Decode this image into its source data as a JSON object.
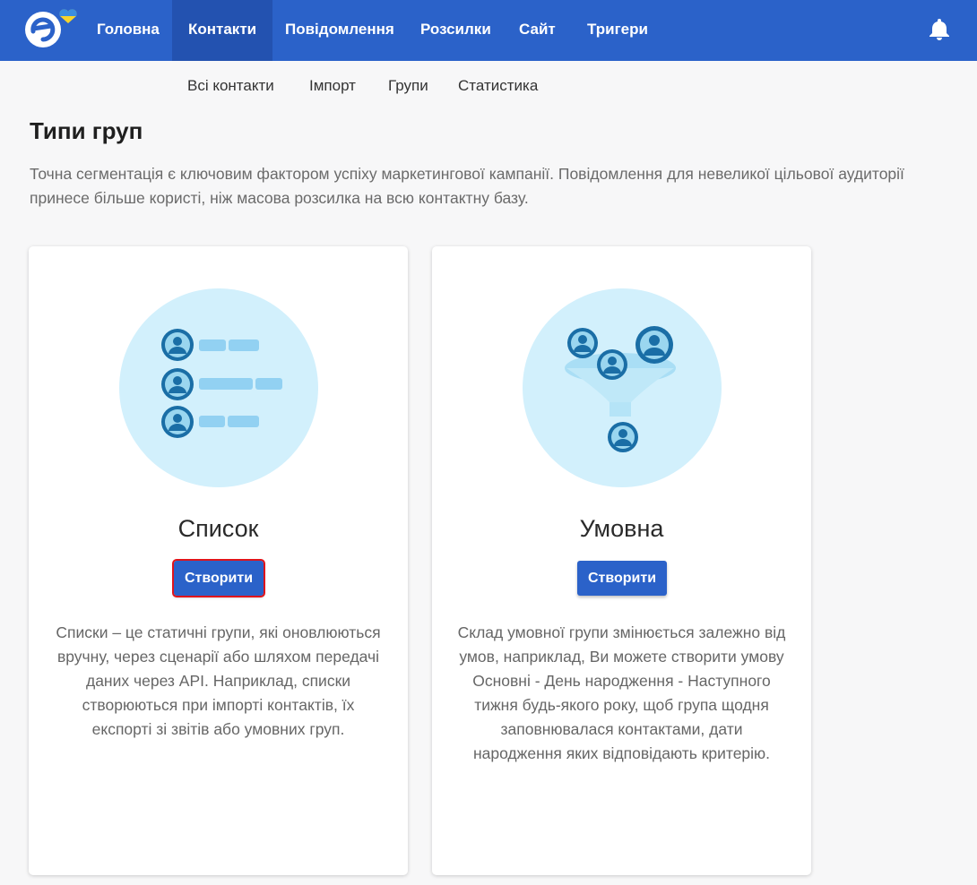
{
  "nav": {
    "items": [
      {
        "label": "Головна"
      },
      {
        "label": "Контакти"
      },
      {
        "label": "Повідомлення"
      },
      {
        "label": "Розсилки"
      },
      {
        "label": "Сайт"
      },
      {
        "label": "Тригери"
      }
    ],
    "active": "Контакти"
  },
  "subnav": {
    "items": [
      {
        "label": "Всі контакти"
      },
      {
        "label": "Імпорт"
      },
      {
        "label": "Групи"
      },
      {
        "label": "Статистика"
      }
    ]
  },
  "page": {
    "title": "Типи груп",
    "description": "Точна сегментація є ключовим фактором успіху маркетингової кампанії. Повідомлення для невеликої цільової аудиторії принесе більше користі, ніж масова розсилка на всю контактну базу."
  },
  "cards": [
    {
      "title": "Список",
      "button": "Створити",
      "text": "Списки – це статичні групи, які оновлюються вручну, через сценарії або шляхом передачі даних через API. Наприклад, списки створюються при імпорті контактів, їх експорті зі звітів або умовних груп."
    },
    {
      "title": "Умовна",
      "button": "Створити",
      "text": "Склад умовної групи змінюється залежно від умов, наприклад, Ви можете створити умову Основні - День народження - Наступного тижня будь-якого року, щоб група щодня заповнювалася контактами, дати народження яких відповідають критерію."
    }
  ],
  "colors": {
    "brand": "#2b62c9",
    "brand_dark": "#2352b0",
    "illustration_bg": "#d2f0fc",
    "focus_outline": "#e0141b"
  },
  "icons": {
    "logo": "esputnik-logo",
    "heart": "ukraine-heart-icon",
    "notifications": "bell-icon"
  }
}
